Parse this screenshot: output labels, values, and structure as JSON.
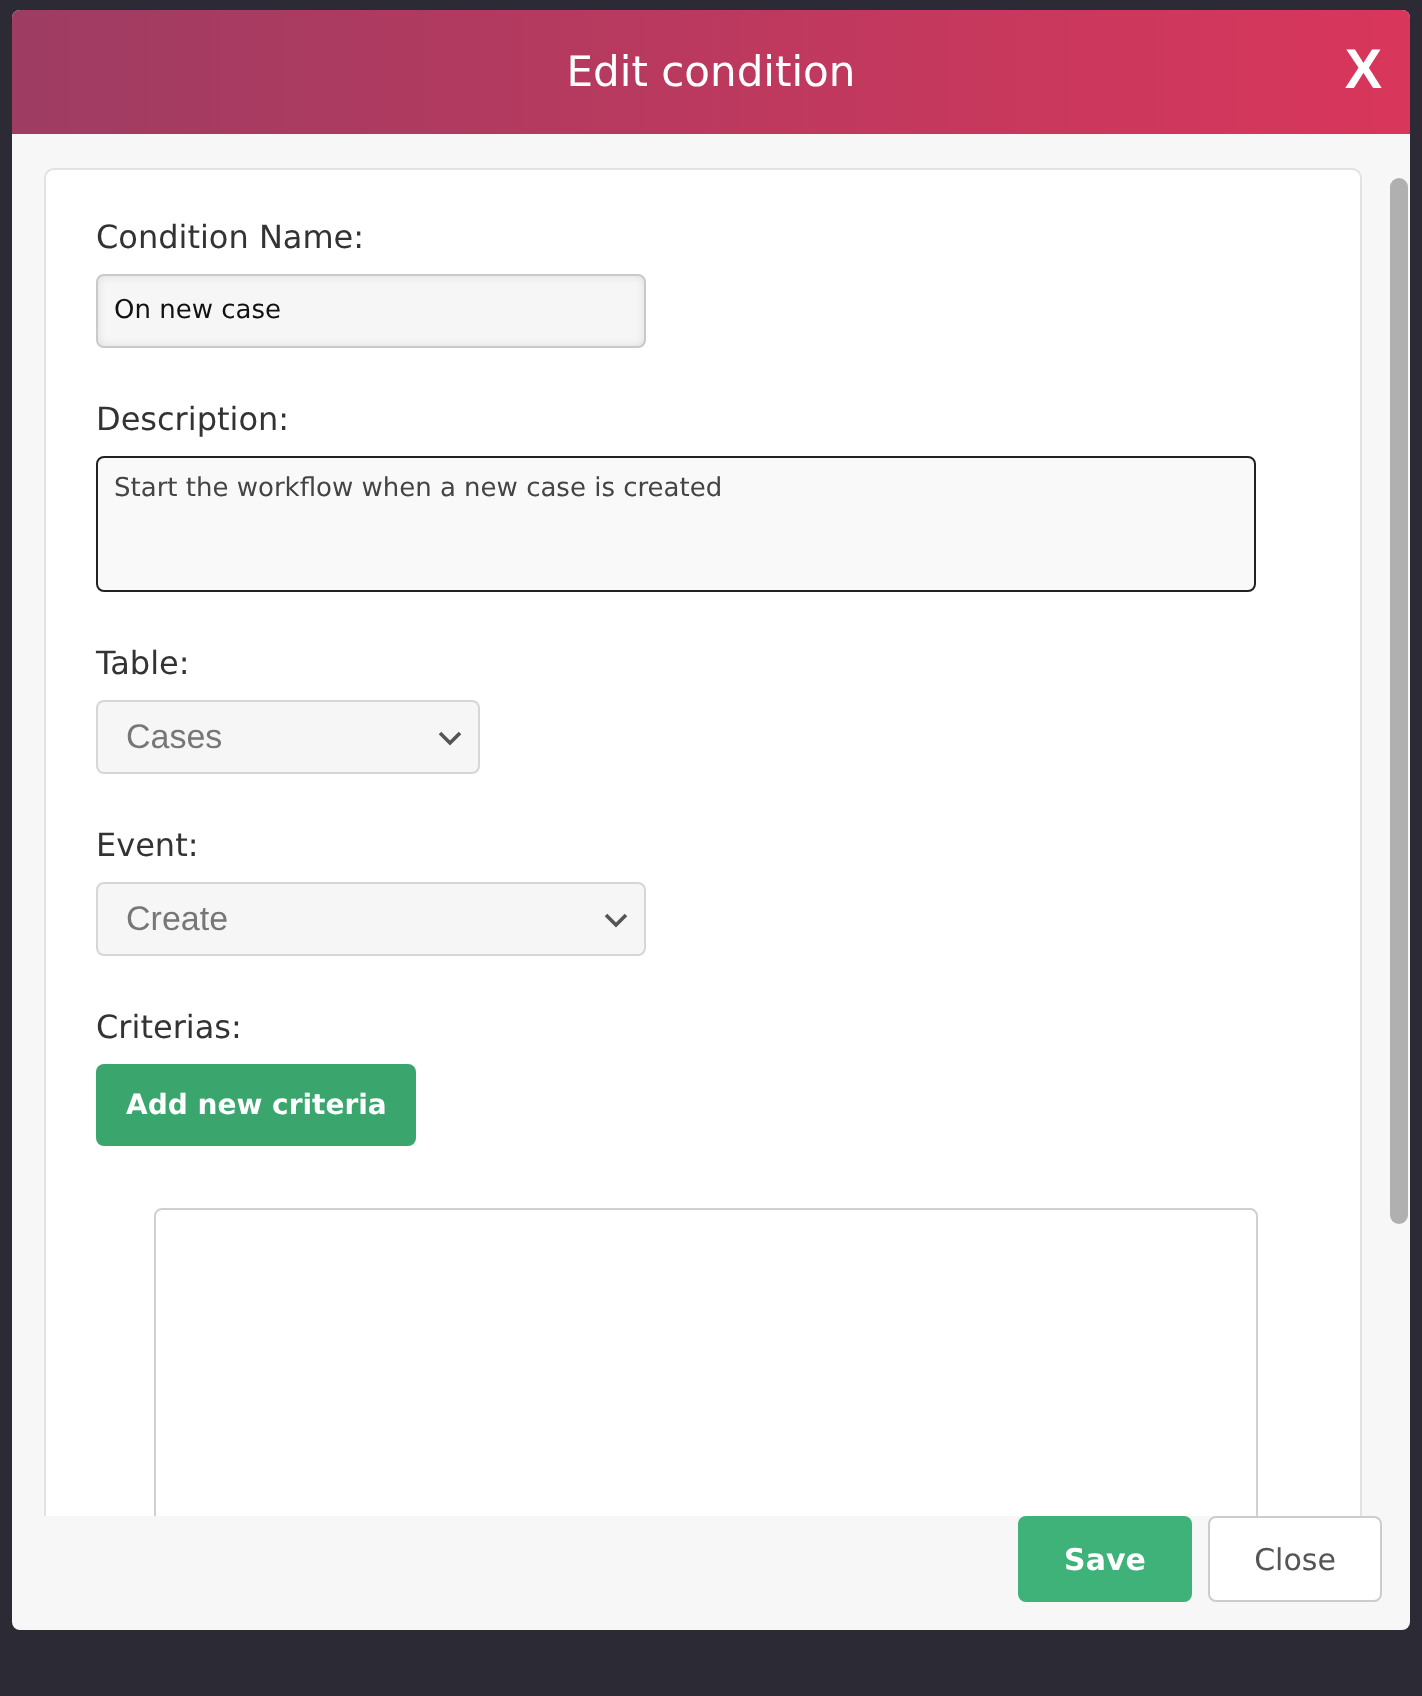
{
  "dialog": {
    "title": "Edit condition",
    "close_glyph": "X"
  },
  "fields": [
    {
      "kind": "text",
      "label": "Condition Name:",
      "value": "On new case"
    },
    {
      "kind": "textarea",
      "label": "Description:",
      "value": "Start the workflow when a new case is created"
    },
    {
      "kind": "select",
      "label": "Table:",
      "value": "Cases"
    },
    {
      "kind": "select-wide",
      "label": "Event:",
      "value": "Create"
    }
  ],
  "criteria": {
    "label": "Criterias:",
    "button": "Add new criteria"
  },
  "footer": {
    "buttons": [
      {
        "label": "Save",
        "kind": "primary"
      },
      {
        "label": "Close",
        "kind": "secondary"
      }
    ]
  }
}
